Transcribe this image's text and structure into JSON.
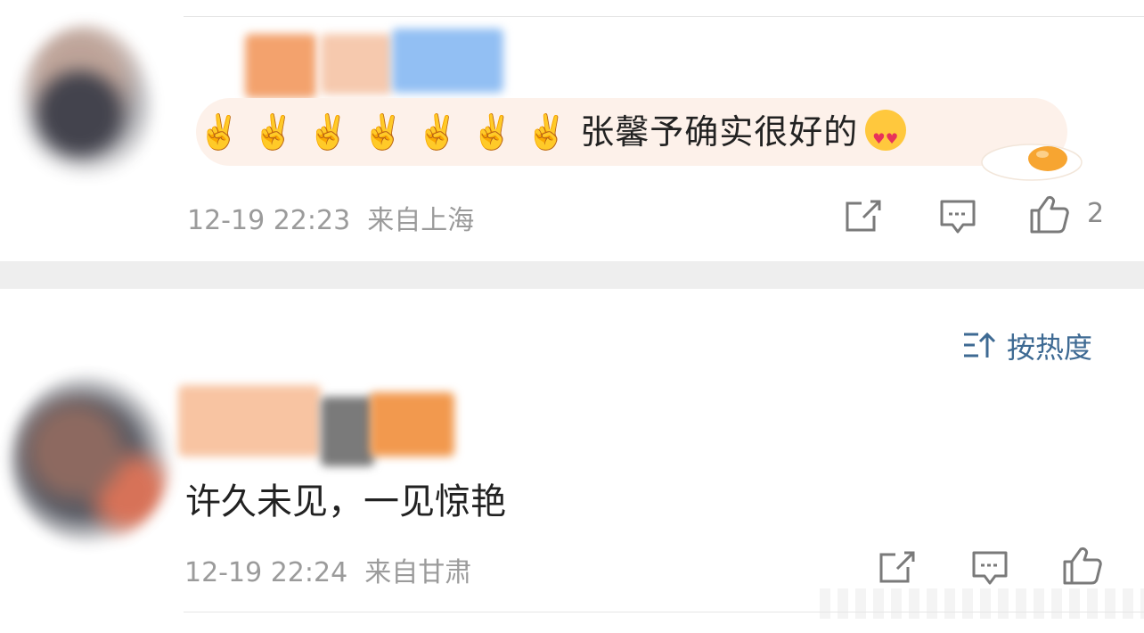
{
  "comments": [
    {
      "text_prefix": "✌️✌️✌️✌️✌️✌️✌️",
      "text_body": "张馨予确实很好的",
      "emoji": "smiling-face-with-heart-eyes-icon",
      "time": "12-19 22:23",
      "location": "来自上海",
      "like_count": "2"
    },
    {
      "text": "许久未见，一见惊艳",
      "time": "12-19 22:24",
      "location": "来自甘肃",
      "like_count": ""
    }
  ],
  "sort": {
    "label": "按热度",
    "icon": "sort-icon"
  },
  "colors": {
    "link": "#3e6a93",
    "meta": "#9b9b9b",
    "highlight": "#fdf1ea",
    "divider": "#eeeeee"
  }
}
